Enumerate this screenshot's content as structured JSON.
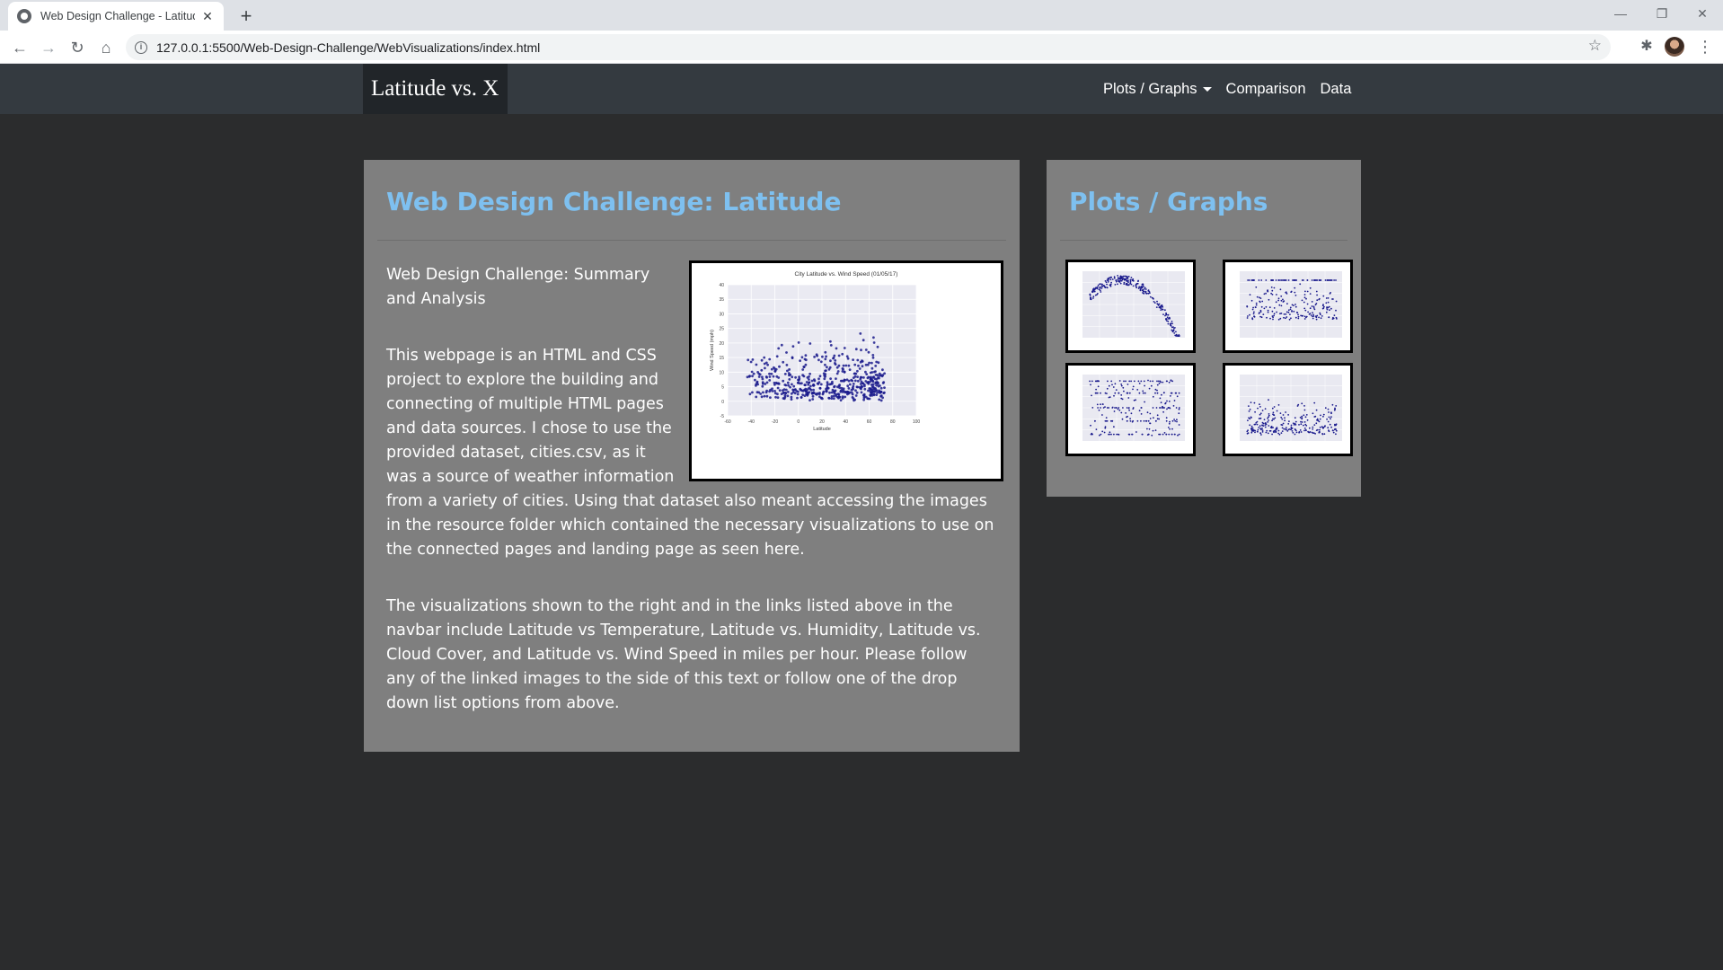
{
  "browser": {
    "tab_title": "Web Design Challenge - Latitude",
    "url": "127.0.0.1:5500/Web-Design-Challenge/WebVisualizations/index.html"
  },
  "navbar": {
    "brand": "Latitude vs. X",
    "links": [
      "Plots / Graphs",
      "Comparison",
      "Data"
    ]
  },
  "main": {
    "title": "Web Design Challenge: Latitude",
    "paragraphs": [
      "Web Design Challenge: Summary and Analysis",
      "This webpage is an HTML and CSS project to explore the building and connecting of multiple HTML pages and data sources. I chose to use the provided dataset, cities.csv, as it was a source of weather information from a variety of cities. Using that dataset also meant accessing the images in the resource folder which contained the necessary visualizations to use on the connected pages and landing page as seen here.",
      "The visualizations shown to the right and in the links listed above in the navbar include Latitude vs Temperature, Latitude vs. Humidity, Latitude vs. Cloud Cover, and Latitude vs. Wind Speed in miles per hour. Please follow any of the linked images to the side of this text or follow one of the drop down list options from above."
    ],
    "chart": {
      "title": "City Latitude vs. Wind Speed (01/05/17)",
      "xlabel": "Latitude",
      "ylabel": "Wind Speed (mph)",
      "xticks": [
        "-60",
        "-40",
        "-20",
        "0",
        "20",
        "40",
        "60",
        "80",
        "100"
      ],
      "yticks": [
        "-5",
        "0",
        "5",
        "10",
        "15",
        "20",
        "25",
        "30",
        "35",
        "40"
      ],
      "point_color": "#1a1a8c"
    }
  },
  "sidebar": {
    "title": "Plots / Graphs",
    "thumbnails": [
      "Latitude vs Temperature",
      "Latitude vs Humidity",
      "Latitude vs Cloudiness",
      "Latitude vs Wind Speed"
    ]
  }
}
